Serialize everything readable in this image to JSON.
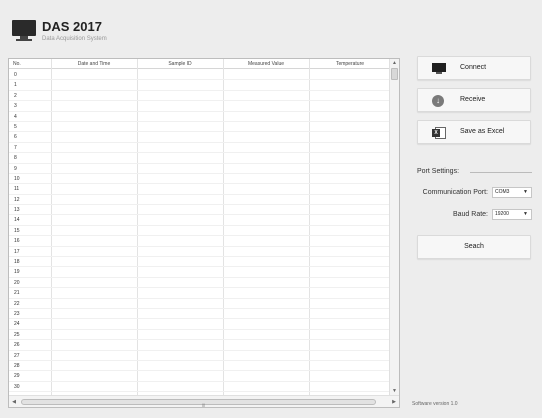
{
  "header": {
    "title": "DAS 2017",
    "subtitle": "Data Acquisition System"
  },
  "table": {
    "columns": [
      "No.",
      "Date and Time",
      "Sample ID",
      "Measured Value",
      "Temperature"
    ],
    "rows": [
      "0",
      "1",
      "2",
      "3",
      "4",
      "5",
      "6",
      "7",
      "8",
      "9",
      "10",
      "11",
      "12",
      "13",
      "14",
      "15",
      "16",
      "17",
      "18",
      "19",
      "20",
      "21",
      "22",
      "23",
      "24",
      "25",
      "26",
      "27",
      "28",
      "29",
      "30"
    ]
  },
  "actions": {
    "connect": "Connect",
    "receive": "Receive",
    "save_excel": "Save as Excel",
    "seach": "Seach"
  },
  "port_settings": {
    "title": "Port Settings:",
    "comm_port_label": "Communication Port:",
    "comm_port_value": "COM3",
    "baud_rate_label": "Baud Rate:",
    "baud_rate_value": "19200"
  },
  "footer": {
    "version": "Software version 1.0"
  },
  "icons": {
    "app": "monitor-icon",
    "connect": "monitor-icon",
    "receive": "download-arrow-icon",
    "save_excel": "excel-icon"
  }
}
